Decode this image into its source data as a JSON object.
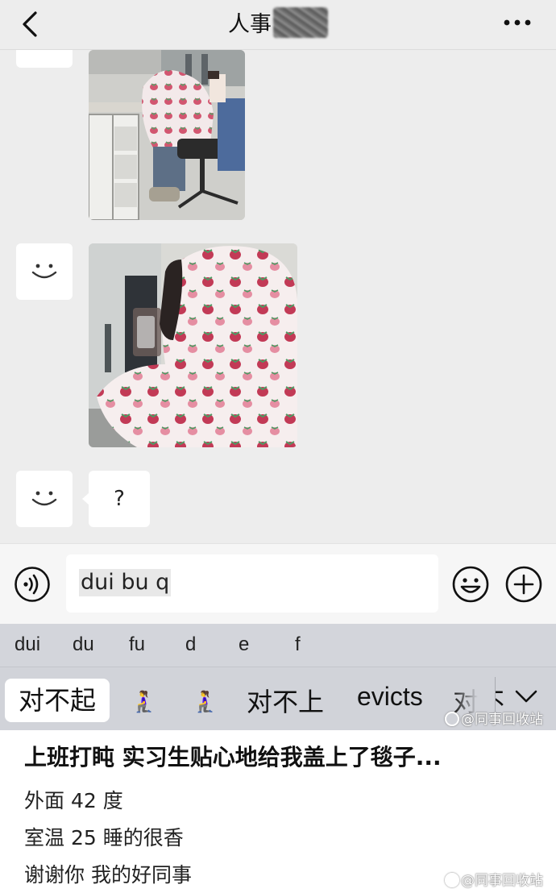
{
  "header": {
    "title": "人事"
  },
  "messages": [
    {
      "type": "image",
      "description_icon": "photo-1"
    },
    {
      "type": "image",
      "description_icon": "photo-2"
    },
    {
      "type": "text",
      "text": "?"
    }
  ],
  "input": {
    "value": "dui bu q"
  },
  "ime": {
    "pinyin_options": [
      "dui",
      "du",
      "fu",
      "d",
      "e",
      "f"
    ],
    "candidates": [
      "对不起",
      "🧎‍♀️",
      "🧎‍♀️",
      "对不上",
      "evicts",
      "对不"
    ]
  },
  "watermarks": [
    "@同事回收站",
    "@同事回收站"
  ],
  "caption": {
    "title": "上班打盹 实习生贴心地给我盖上了毯子...",
    "lines": [
      "外面 42 度",
      "室温 25 睡的很香",
      "谢谢你 我的好同事"
    ]
  },
  "colors": {
    "chat_bg": "#ededed",
    "keyboard_bg": "#d1d3d9",
    "blanket_pink": "#e58ea2",
    "strawberry": "#c23a56"
  }
}
